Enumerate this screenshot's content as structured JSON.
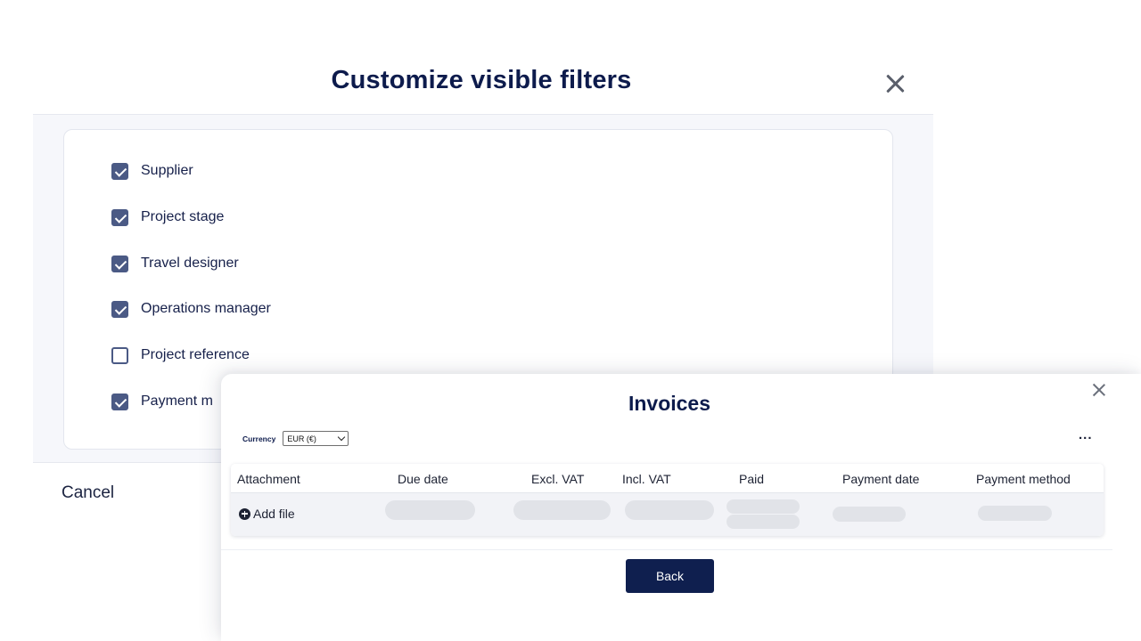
{
  "filters_dialog": {
    "title": "Customize visible filters",
    "items": [
      {
        "label": "Supplier",
        "checked": true
      },
      {
        "label": "Project stage",
        "checked": true
      },
      {
        "label": "Travel designer",
        "checked": true
      },
      {
        "label": "Operations manager",
        "checked": true
      },
      {
        "label": "Project reference",
        "checked": false
      },
      {
        "label": "Payment m",
        "checked": true
      }
    ],
    "cancel_label": "Cancel"
  },
  "invoices_modal": {
    "title": "Invoices",
    "currency_label": "Currency",
    "currency_value": "EUR (€)",
    "more_label": "...",
    "columns": [
      "Attachment",
      "Due date",
      "Excl. VAT",
      "Incl. VAT",
      "Paid",
      "Payment date",
      "Payment method"
    ],
    "add_file_label": "Add file",
    "back_label": "Back"
  },
  "icons": {
    "filters_close": "close-icon",
    "invoices_close": "close-icon",
    "add_file": "plus-circle-icon",
    "currency_dropdown": "chevron-down-icon",
    "checkbox_checked": "checkmark-icon"
  },
  "colors": {
    "title_navy": "#0d1b4c",
    "checkbox": "#4b5a85",
    "primary_button": "#0f1f4f",
    "panel_bg": "#f6f7fb",
    "row_bg": "#f2f3f7",
    "skeleton": "#e1e3e8"
  }
}
